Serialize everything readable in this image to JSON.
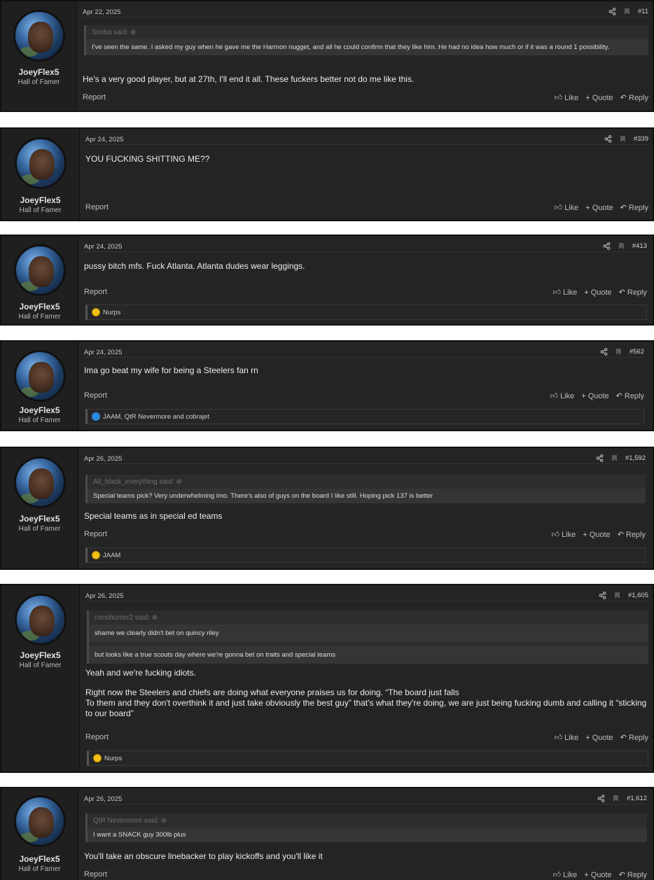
{
  "user": {
    "name": "JoeyFlex5",
    "title": "Hall of Famer"
  },
  "labels": {
    "report": "Report",
    "like": "Like",
    "quote": "Quote",
    "reply": "Reply"
  },
  "posts": [
    {
      "date": "Apr 22, 2025",
      "number": "#11",
      "quote": {
        "author": "Simba said:",
        "lines": [
          "I've seen the same. I asked my guy when he gave me the Harmon nugget, and all he could confirm that they like him. He had no idea how much or if it was a round 1 possibility."
        ]
      },
      "message": [
        "He's a very good player, but at 27th, I'll end it all. These fuckers better not do me like this."
      ]
    },
    {
      "date": "Apr 24, 2025",
      "number": "#339",
      "message": [
        "YOU FUCKING SHITTING ME??"
      ]
    },
    {
      "date": "Apr 24, 2025",
      "number": "#413",
      "message": [
        "pussy bitch mfs. Fuck Atlanta. Atlanta dudes wear leggings."
      ],
      "reactions": {
        "icon": "laugh-reaction-icon",
        "users": "Nurps"
      }
    },
    {
      "date": "Apr 24, 2025",
      "number": "#562",
      "message": [
        "Ima go beat my wife for being a Steelers fan rn"
      ],
      "reactions": {
        "icon": "like-reaction-icon",
        "users": "JAAM, QtR Nevermore and cobrajet"
      }
    },
    {
      "date": "Apr 26, 2025",
      "number": "#1,592",
      "quote": {
        "author": "All_black_everything said:",
        "lines": [
          "Special teams pick? Very underwhelming imo. There's also of guys on the board I like still. Hoping pick 137 is better"
        ]
      },
      "message": [
        "Special teams as in special ed teams"
      ],
      "reactions": {
        "icon": "laugh-reaction-icon",
        "users": "JAAM"
      }
    },
    {
      "date": "Apr 26, 2025",
      "number": "#1,605",
      "quote": {
        "author": "rossihunter2 said:",
        "lines": [
          "shame we clearly didn't bet on quincy riley",
          "but looks like a true scouts day where we're gonna bet on traits and special teams"
        ]
      },
      "message": [
        "Yeah and we're fucking idiots.",
        "",
        "Right now the Steelers and chiefs are doing what everyone praises us for doing. “The board just falls",
        "To them and they don't overthink it and just take obviously the best guy” that's what they're doing, we are just being fucking dumb and calling it “sticking",
        "to our board”"
      ],
      "reactions": {
        "icon": "laugh-reaction-icon",
        "users": "Nurps"
      }
    },
    {
      "date": "Apr 26, 2025",
      "number": "#1,612",
      "quote": {
        "author": "QtR Nevermore said:",
        "lines": [
          "I want a SNACK guy 300lb plus"
        ]
      },
      "message": [
        "You'll take an obscure linebacker to play kickoffs and you'll like it"
      ]
    }
  ]
}
